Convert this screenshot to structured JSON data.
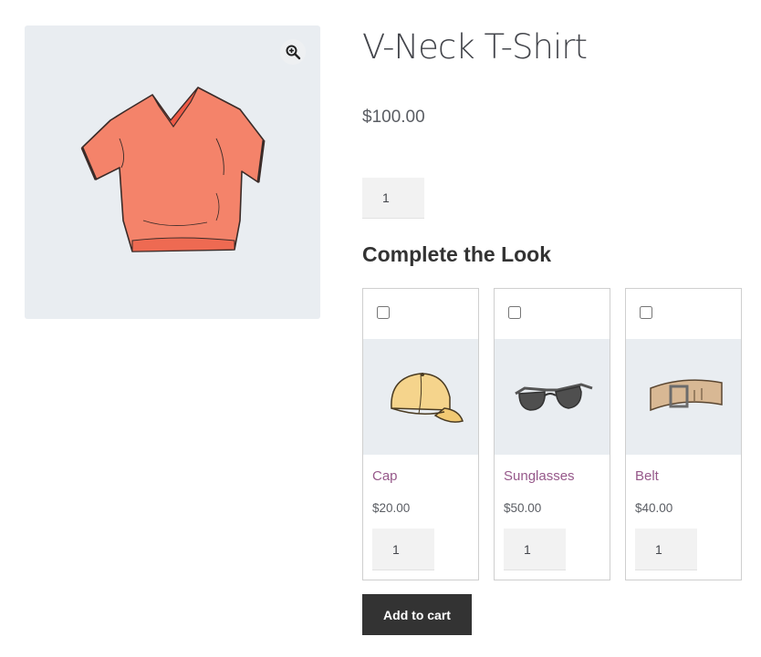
{
  "product": {
    "title": "V-Neck T-Shirt",
    "price": "$100.00",
    "quantity": "1",
    "image_icon": "tshirt-image",
    "zoom_icon": "magnify-plus-icon"
  },
  "complete_the_look": {
    "heading": "Complete the Look",
    "items": [
      {
        "name": "Cap",
        "price": "$20.00",
        "quantity": "1",
        "checked": false,
        "image_icon": "cap-image"
      },
      {
        "name": "Sunglasses",
        "price": "$50.00",
        "quantity": "1",
        "checked": false,
        "image_icon": "sunglasses-image"
      },
      {
        "name": "Belt",
        "price": "$40.00",
        "quantity": "1",
        "checked": false,
        "image_icon": "belt-image"
      }
    ]
  },
  "actions": {
    "add_to_cart_label": "Add to cart"
  },
  "colors": {
    "link": "#96588a",
    "button_bg": "#333333",
    "image_bg": "#e9edf1"
  }
}
